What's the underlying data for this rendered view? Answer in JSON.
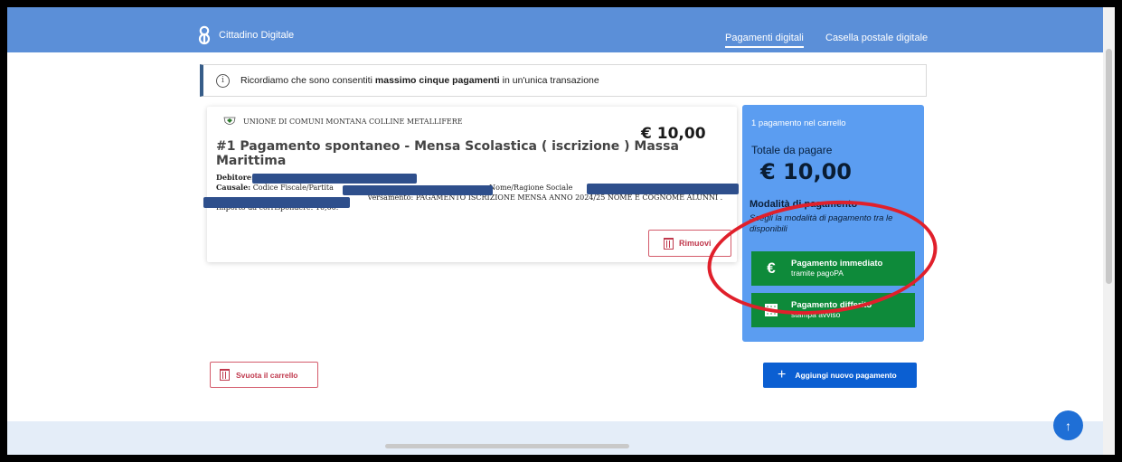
{
  "header": {
    "brand": "Cittadino Digitale",
    "nav": [
      "Pagamenti digitali",
      "Casella postale digitale"
    ]
  },
  "notice": {
    "text_before": "Ricordiamo che sono consentiti",
    "text_bold": "massimo cinque pagamenti",
    "text_after": "in un'unica transazione"
  },
  "payment": {
    "organization": "UNIONE DI COMUNI MONTANA COLLINE METALLIFERE",
    "amount": "€ 10,00",
    "title": "#1 Pagamento spontaneo - Mensa Scolastica ( iscrizione ) Massa Marittima",
    "debtor_label": "Debitore:",
    "causale_label": "Causale:",
    "causale_part1": "Codice Fiscale/Partita",
    "causale_part2": "e Nome/Ragione Sociale",
    "causale_part3": "versamento: PAGAMENTO ISCRIZIONE MENSA ANNO 2024/25 NOME E COGNOME ALUNNI .",
    "importo": "Importo da corrispondere: 10,00.",
    "remove_label": "Rimuovi"
  },
  "cart": {
    "count_text": "1 pagamento nel carrello",
    "total_label": "Totale da pagare",
    "total": "€ 10,00",
    "modality_title": "Modalità di pagamento",
    "modality_subtitle": "Scegli la modalità di pagamento tra le disponibili",
    "option_immediate_title": "Pagamento immediato",
    "option_immediate_sub": "tramite pagoPA",
    "option_deferred_title": "Pagamento differito",
    "option_deferred_sub": "stampa avviso"
  },
  "actions": {
    "empty_cart": "Svuota il carrello",
    "add_payment": "Aggiungi nuovo pagamento"
  },
  "colors": {
    "header": "#5b8fd8",
    "cart_panel": "#5b9df1",
    "pay_button": "#0e8a3a",
    "primary": "#0b5fd2",
    "danger": "#c0394d",
    "annotation": "#e0202b",
    "redaction": "#2e4f8c"
  },
  "icons": {
    "brand": "cittadino-digitale-logo",
    "notice": "info-icon",
    "org": "crest-icon",
    "remove": "trash-icon",
    "immediate": "euro-icon",
    "deferred": "qr-code-icon",
    "add": "plus-icon",
    "back_to_top": "arrow-up-icon"
  }
}
